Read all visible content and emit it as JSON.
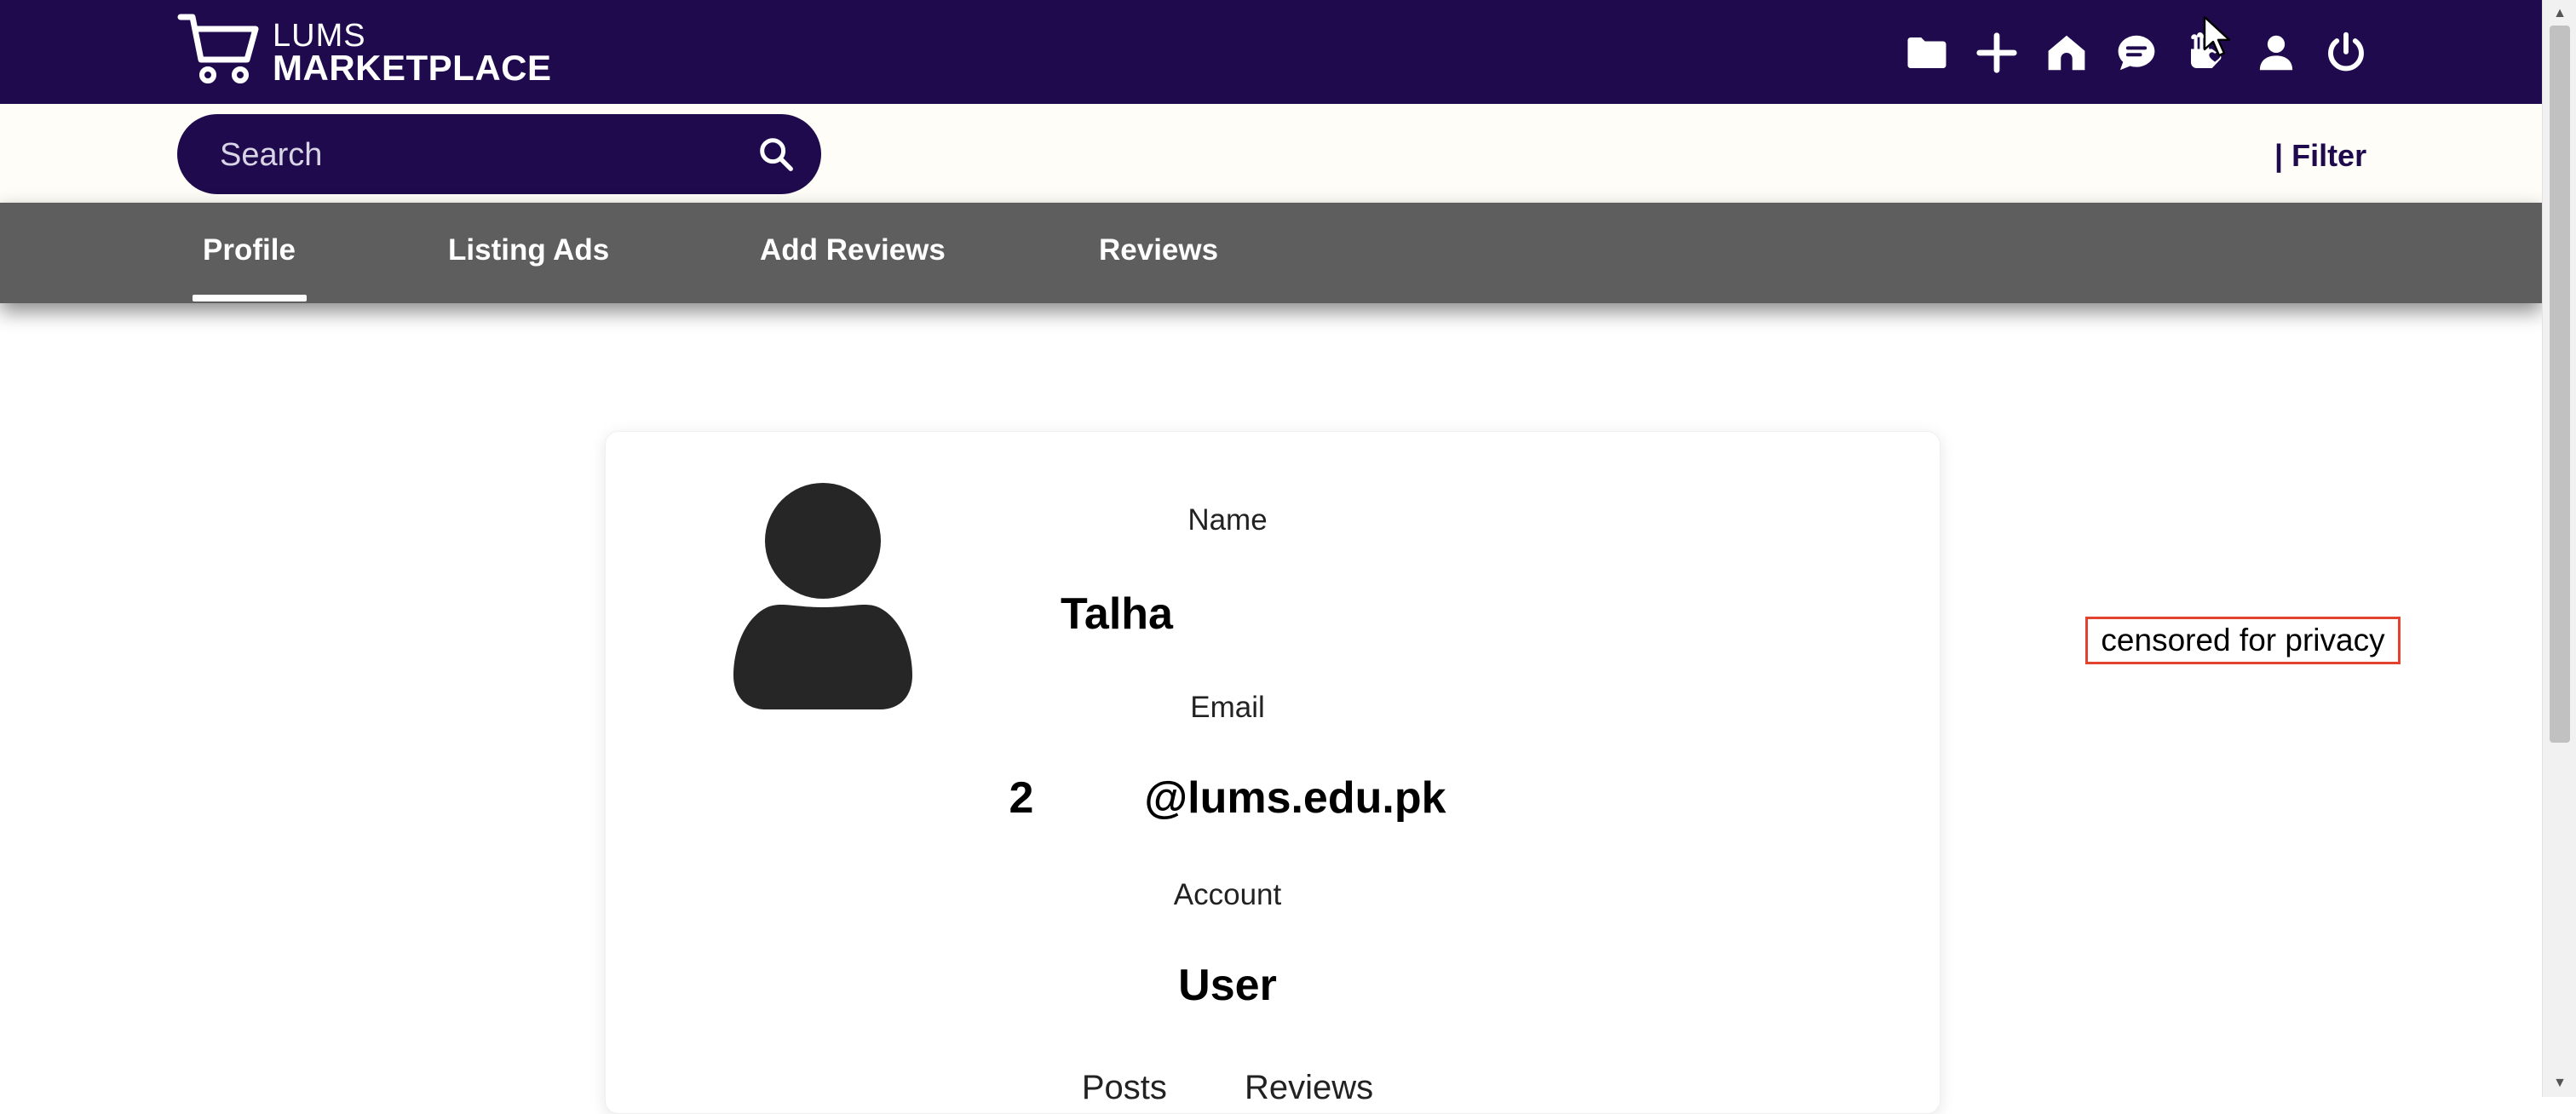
{
  "header": {
    "logo_top": "LUMS",
    "logo_bottom": "MARKETPLACE",
    "icons": [
      "folder-icon",
      "plus-icon",
      "home-icon",
      "chat-icon",
      "hand-heart-icon",
      "user-icon",
      "power-icon"
    ]
  },
  "search": {
    "placeholder": "Search"
  },
  "filter": {
    "label": "| Filter"
  },
  "tabs": [
    {
      "label": "Profile",
      "active": true
    },
    {
      "label": "Listing Ads",
      "active": false
    },
    {
      "label": "Add Reviews",
      "active": false
    },
    {
      "label": "Reviews",
      "active": false
    }
  ],
  "profile": {
    "name_label": "Name",
    "name_value": "Talha",
    "email_label": "Email",
    "email_value": "2         @lums.edu.pk",
    "account_label": "Account",
    "account_value": "User",
    "posts_label": "Posts",
    "reviews_label": "Reviews"
  },
  "overlay": {
    "censored_text": "censored for privacy"
  },
  "colors": {
    "brand": "#1f0a4e",
    "tabs_bg": "#5e5e5e",
    "censor_border": "#e2432f"
  }
}
